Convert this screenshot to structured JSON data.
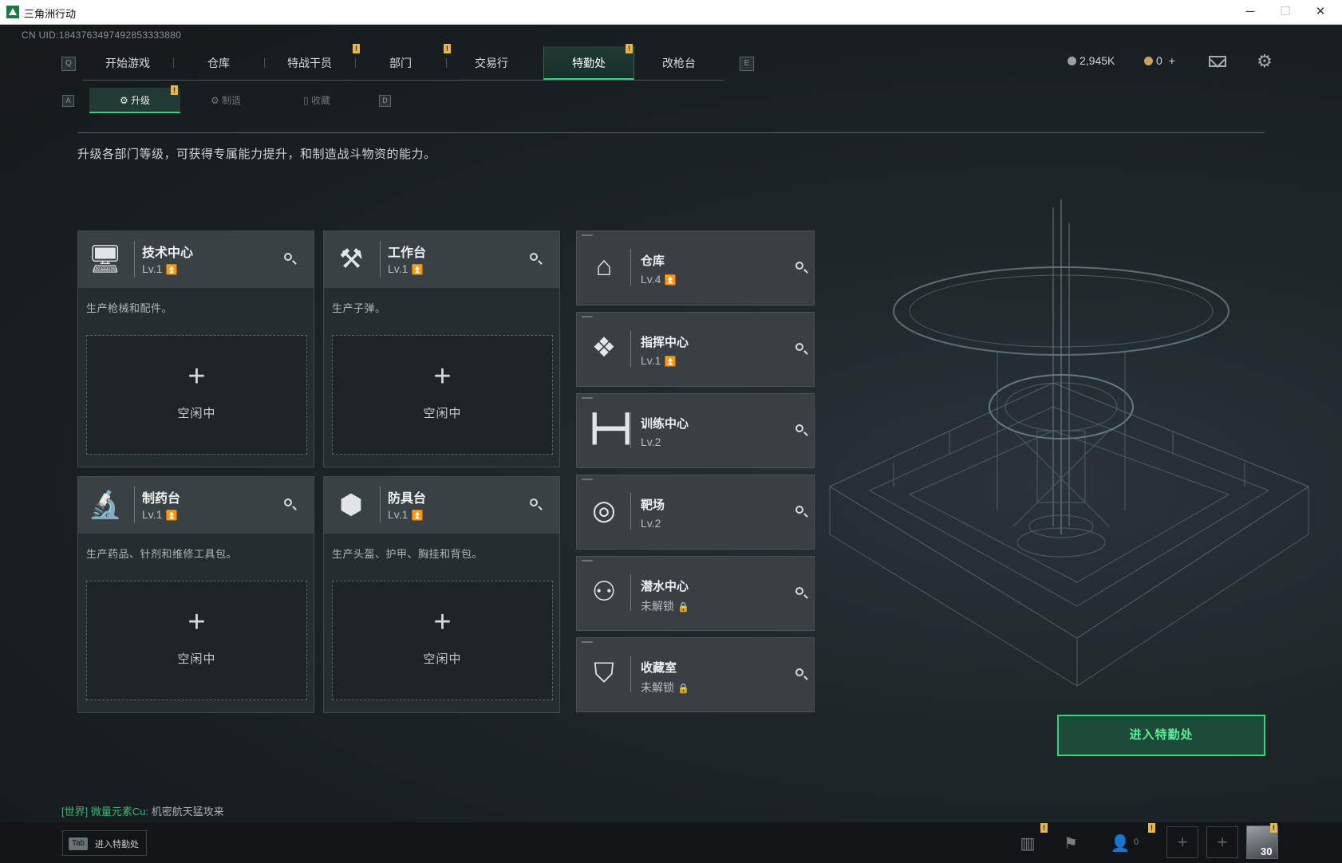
{
  "window": {
    "title": "三角洲行动",
    "minimize": "─",
    "maximize": "☐",
    "close": "✕"
  },
  "uid": "CN UID:1843763497492853333880",
  "topnav": {
    "key_left": "Q",
    "key_right": "E",
    "tabs": [
      {
        "label": "开始游戏"
      },
      {
        "label": "仓库"
      },
      {
        "label": "特战干员"
      },
      {
        "label": "部门"
      },
      {
        "label": "交易行"
      },
      {
        "label": "特勤处"
      },
      {
        "label": "改枪台"
      }
    ],
    "active_tab": "特勤处"
  },
  "subnav": {
    "key_left": "A",
    "key_right": "D",
    "tabs": [
      {
        "label": "升级"
      },
      {
        "label": "制造"
      },
      {
        "label": "收藏"
      }
    ],
    "active_tab": "升级"
  },
  "currency": {
    "silver": "2,945K",
    "gold": "0",
    "gold_add": "+"
  },
  "description": "升级各部门等级，可获得专属能力提升，和制造战斗物资的能力。",
  "badge": "!",
  "big_cards": [
    {
      "name": "技术中心",
      "level": "Lv.1",
      "desc": "生产枪械和配件。",
      "slot": "空闲中",
      "icon": "computer-icon"
    },
    {
      "name": "工作台",
      "level": "Lv.1",
      "desc": "生产子弹。",
      "slot": "空闲中",
      "icon": "tools-icon"
    },
    {
      "name": "制药台",
      "level": "Lv.1",
      "desc": "生产药品、针剂和维修工具包。",
      "slot": "空闲中",
      "icon": "microscope-icon"
    },
    {
      "name": "防具台",
      "level": "Lv.1",
      "desc": "生产头盔、护甲、胸挂和背包。",
      "slot": "空闲中",
      "icon": "armor-boxes-icon"
    }
  ],
  "plus_sign": "+",
  "up_arrow": "⏫",
  "lock_glyph": "🔒",
  "small_cards": [
    {
      "name": "仓库",
      "level": "Lv.4",
      "icon": "warehouse-icon",
      "upgradable": true
    },
    {
      "name": "指挥中心",
      "level": "Lv.1",
      "icon": "command-center-icon",
      "upgradable": true
    },
    {
      "name": "训练中心",
      "level": "Lv.2",
      "icon": "dumbbell-icon",
      "upgradable": false
    },
    {
      "name": "靶场",
      "level": "Lv.2",
      "icon": "target-icon",
      "upgradable": false
    },
    {
      "name": "潜水中心",
      "level": "未解锁",
      "icon": "diving-mask-icon",
      "locked": true
    },
    {
      "name": "收藏室",
      "level": "未解锁",
      "icon": "collection-case-icon",
      "locked": true
    }
  ],
  "enter_button": "进入特勤处",
  "chat": {
    "tag": "[世界] 微量元素Cu:",
    "message": "机密航天猛攻来"
  },
  "bottom": {
    "tab_key": "Tab",
    "tab_label": "进入特勤处",
    "friends_count": "0",
    "avatar_level": "30"
  },
  "colors": {
    "accent": "#2fd67a",
    "badge": "#e9b83c",
    "card_head": "#3a4145",
    "background": "#1b2125"
  }
}
